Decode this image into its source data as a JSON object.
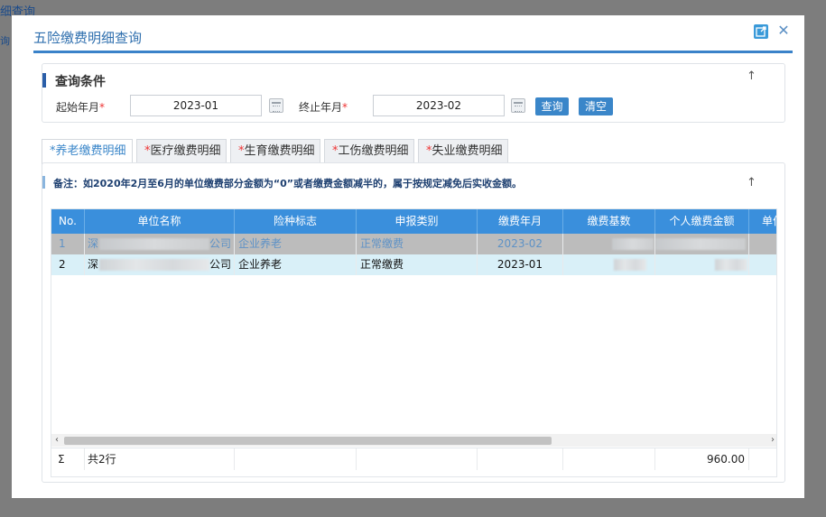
{
  "background": {
    "title": "细查询",
    "sub": "询"
  },
  "dialog": {
    "title": "五险缴费明细查询",
    "external_icon": "external-link-icon",
    "close_icon": "close-icon"
  },
  "query": {
    "section_title": "查询条件",
    "start_label": "起始年月",
    "start_value": "2023-01",
    "end_label": "终止年月",
    "end_value": "2023-02",
    "required_mark": "*",
    "search_button": "查询",
    "clear_button": "清空",
    "collapse_symbol": "↑"
  },
  "tabs": [
    {
      "label": "养老缴费明细",
      "active": true
    },
    {
      "label": "医疗缴费明细",
      "active": false
    },
    {
      "label": "生育缴费明细",
      "active": false
    },
    {
      "label": "工伤缴费明细",
      "active": false
    },
    {
      "label": "失业缴费明细",
      "active": false
    }
  ],
  "detail": {
    "note": "备注：如2020年2月至6月的单位缴费部分金额为“0”或者缴费金额减半的，属于按规定减免后实收金额。",
    "collapse_symbol": "↑"
  },
  "table": {
    "columns": [
      "No.",
      "单位名称",
      "险种标志",
      "申报类别",
      "缴费年月",
      "缴费基数",
      "个人缴费金额",
      "单位"
    ],
    "rows": [
      {
        "no": "1",
        "company_prefix": "深",
        "company_suffix": "公司",
        "insurance": "企业养老",
        "category": "正常缴费",
        "month": "2023-02"
      },
      {
        "no": "2",
        "company_prefix": "深",
        "company_suffix": "公司",
        "insurance": "企业养老",
        "category": "正常缴费",
        "month": "2023-01"
      }
    ],
    "summary": {
      "symbol": "Σ",
      "count": "共2行",
      "personal_total": "960.00"
    }
  },
  "colors": {
    "accent": "#3a8fdc",
    "header": "#3a8fdc",
    "selected_row": "#d9f0f8"
  }
}
